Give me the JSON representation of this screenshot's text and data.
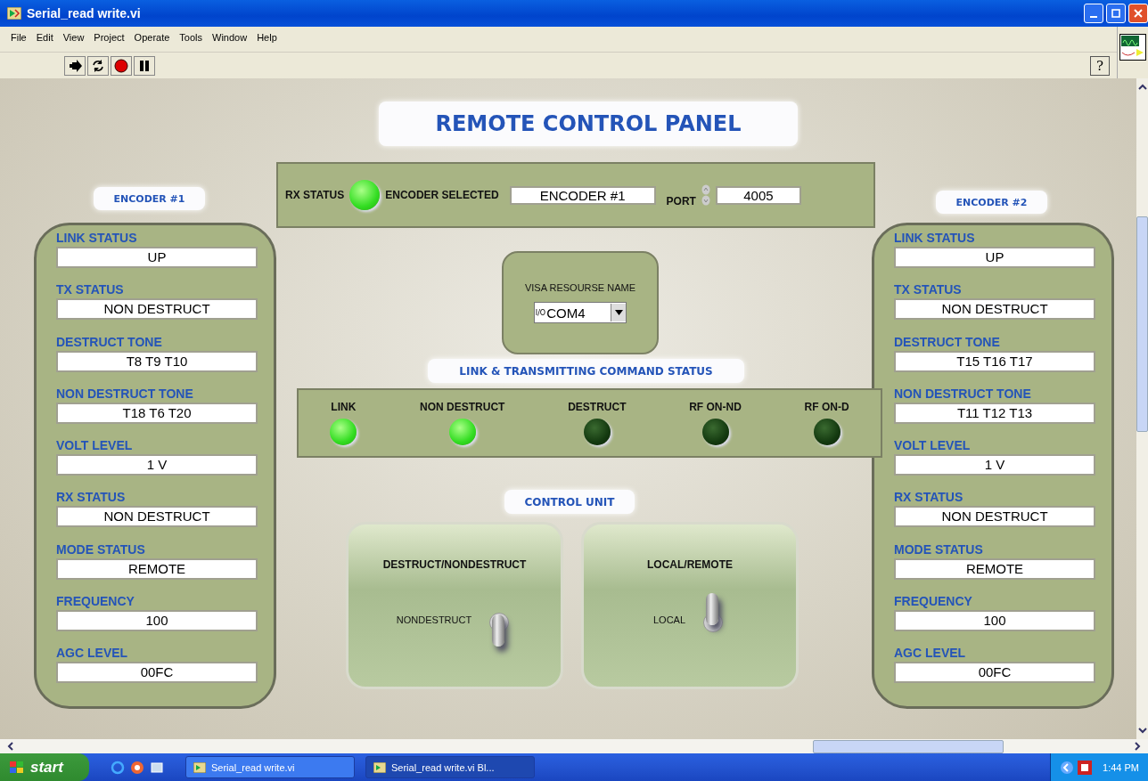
{
  "window": {
    "title": "Serial_read write.vi"
  },
  "menu": [
    "File",
    "Edit",
    "View",
    "Project",
    "Operate",
    "Tools",
    "Window",
    "Help"
  ],
  "toolbar": [
    {
      "kind": "run"
    },
    {
      "kind": "continuous"
    },
    {
      "kind": "abort"
    },
    {
      "kind": "pause"
    }
  ],
  "help_button": "?",
  "panel_title": "REMOTE CONTROL PANEL",
  "top_bar": {
    "rx_status_label": "RX STATUS",
    "rx_status_on": true,
    "encoder_selected_label": "ENCODER SELECTED",
    "encoder_selected": "ENCODER #1",
    "port_label": "PORT",
    "port": "4005"
  },
  "encoders": [
    {
      "title": "ENCODER #1",
      "fields": [
        {
          "label": "LINK STATUS",
          "value": "UP"
        },
        {
          "label": "TX STATUS",
          "value": "NON DESTRUCT"
        },
        {
          "label": "DESTRUCT TONE",
          "value": "T8 T9 T10"
        },
        {
          "label": "NON DESTRUCT TONE",
          "value": "T18 T6 T20"
        },
        {
          "label": "VOLT LEVEL",
          "value": "1 V"
        },
        {
          "label": "RX STATUS",
          "value": "NON DESTRUCT"
        },
        {
          "label": "MODE STATUS",
          "value": "REMOTE"
        },
        {
          "label": "FREQUENCY",
          "value": "100"
        },
        {
          "label": "AGC LEVEL",
          "value": "00FC"
        }
      ]
    },
    {
      "title": "ENCODER #2",
      "fields": [
        {
          "label": "LINK STATUS",
          "value": "UP"
        },
        {
          "label": "TX STATUS",
          "value": "NON DESTRUCT"
        },
        {
          "label": "DESTRUCT TONE",
          "value": "T15 T16 T17"
        },
        {
          "label": "NON DESTRUCT TONE",
          "value": "T11 T12 T13"
        },
        {
          "label": "VOLT LEVEL",
          "value": "1 V"
        },
        {
          "label": "RX STATUS",
          "value": "NON DESTRUCT"
        },
        {
          "label": "MODE STATUS",
          "value": "REMOTE"
        },
        {
          "label": "FREQUENCY",
          "value": "100"
        },
        {
          "label": "AGC LEVEL",
          "value": "00FC"
        }
      ]
    }
  ],
  "visa": {
    "label": "VISA RESOURSE NAME",
    "prefix": "I/O",
    "value": "COM4"
  },
  "status_title": "LINK & TRANSMITTING COMMAND STATUS",
  "leds": [
    {
      "label": "LINK",
      "on": true
    },
    {
      "label": "NON DESTRUCT",
      "on": true
    },
    {
      "label": "DESTRUCT",
      "on": false
    },
    {
      "label": "RF ON-ND",
      "on": false
    },
    {
      "label": "RF ON-D",
      "on": false
    }
  ],
  "control_title": "CONTROL UNIT",
  "switches": [
    {
      "title": "DESTRUCT/NONDESTRUCT",
      "label": "NONDESTRUCT",
      "up": false
    },
    {
      "title": "LOCAL/REMOTE",
      "label": "LOCAL",
      "up": true
    }
  ],
  "taskbar": {
    "start": "start",
    "tasks": [
      {
        "label": "Serial_read write.vi",
        "selected": false
      },
      {
        "label": "Serial_read write.vi Bl...",
        "selected": true
      }
    ],
    "time": "1:44 PM"
  }
}
